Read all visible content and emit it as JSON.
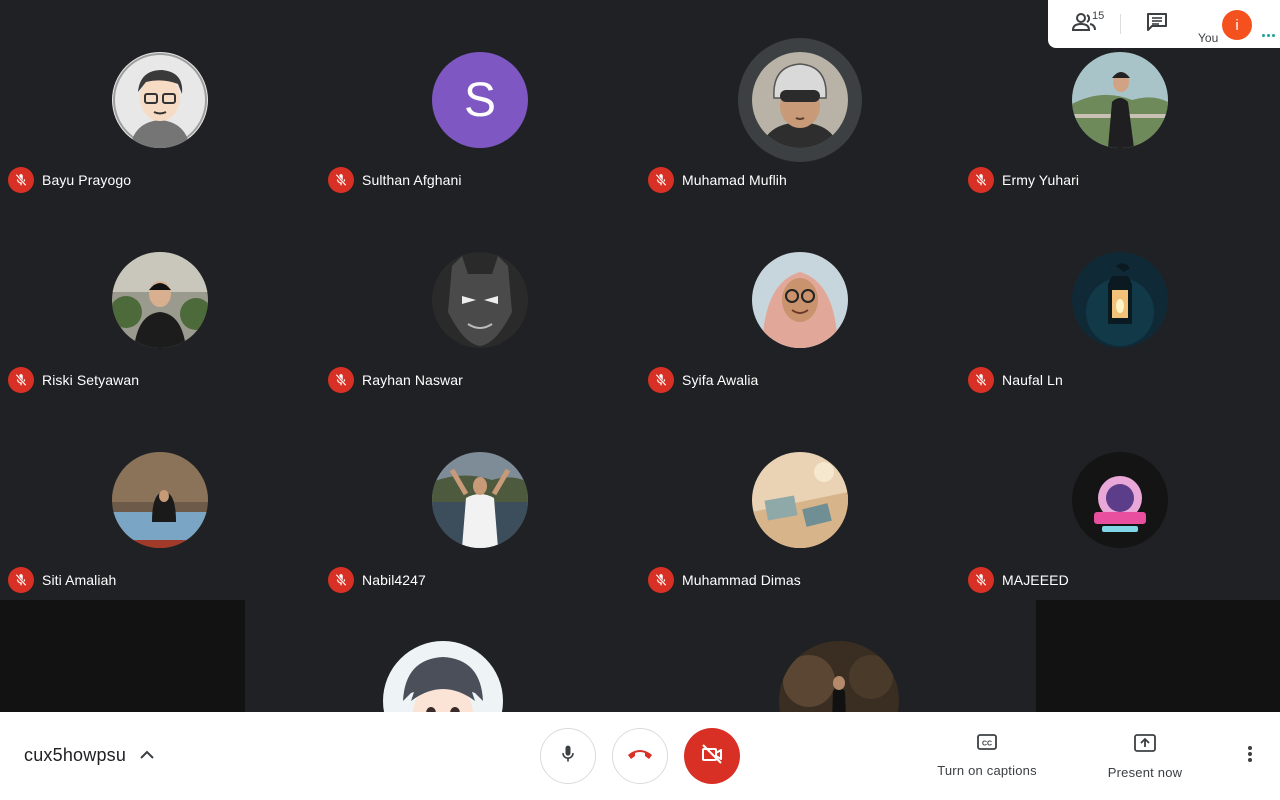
{
  "top_bar": {
    "participant_count": "15",
    "you_label": "You",
    "you_initial": "i",
    "you_color": "#f4511e"
  },
  "participants": [
    {
      "name": "Bayu Prayogo",
      "avatar": "cartoon-photo",
      "muted": true
    },
    {
      "name": "Sulthan Afghani",
      "avatar_letter": "S",
      "avatar_color": "#7e57c2",
      "muted": true
    },
    {
      "name": "Muhamad Muflih",
      "avatar": "helmet-photo",
      "muted": true,
      "speaking": true
    },
    {
      "name": "Ermy Yuhari",
      "avatar": "landscape-photo",
      "muted": true
    },
    {
      "name": "Riski Setyawan",
      "avatar": "outdoor-photo",
      "muted": true
    },
    {
      "name": "Rayhan Naswar",
      "avatar": "batman-photo",
      "muted": true
    },
    {
      "name": "Syifa Awalia",
      "avatar": "hijab-photo",
      "muted": true
    },
    {
      "name": "Naufal Ln",
      "avatar": "lantern-photo",
      "muted": true
    },
    {
      "name": "Siti Amaliah",
      "avatar": "room-photo",
      "muted": true
    },
    {
      "name": "Nabil4247",
      "avatar": "lake-photo",
      "muted": true
    },
    {
      "name": "Muhammad Dimas",
      "avatar": "desk-photo",
      "muted": true
    },
    {
      "name": "MAJEEED",
      "avatar": "logo-photo",
      "muted": true
    }
  ],
  "bottom_bar": {
    "meeting_code": "cux5howpsu",
    "captions_label": "Turn on captions",
    "present_label": "Present now"
  },
  "colors": {
    "background": "#202124",
    "mute_red": "#d93025",
    "end_call_red": "#d93025"
  }
}
